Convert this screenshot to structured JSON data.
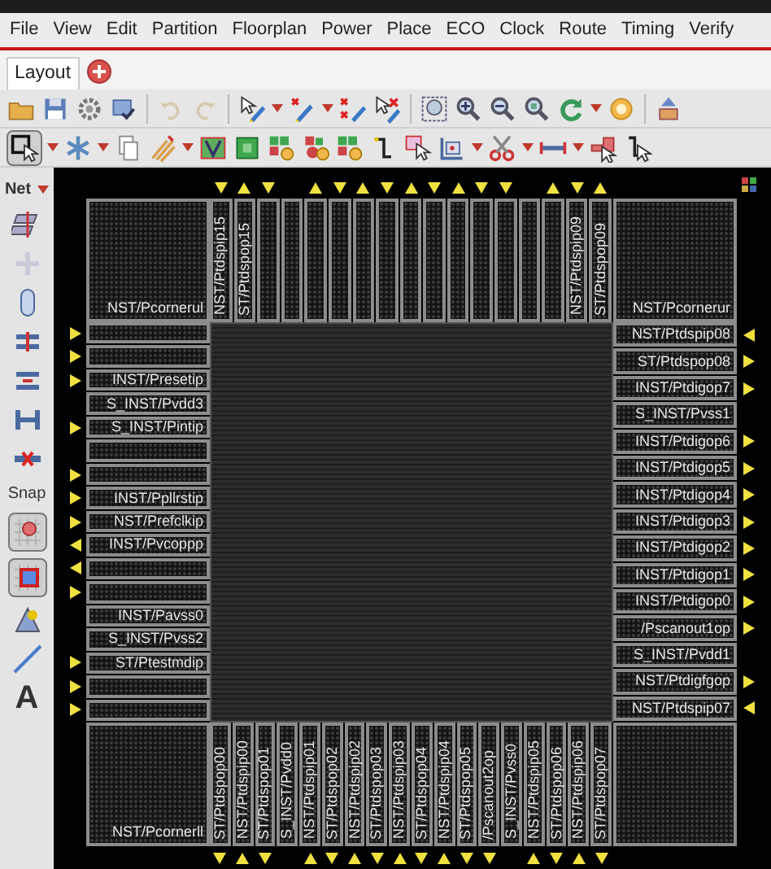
{
  "menu": [
    "File",
    "View",
    "Edit",
    "Partition",
    "Floorplan",
    "Power",
    "Place",
    "ECO",
    "Clock",
    "Route",
    "Timing",
    "Verify"
  ],
  "tabs": [
    {
      "label": "Layout",
      "selected": true
    }
  ],
  "palette": {
    "net_label": "Net",
    "snap_label": "Snap",
    "text_tool": "A"
  },
  "die": {
    "corners": [
      {
        "label": "NST/Pcornerul"
      },
      {
        "label": "NST/Pcornerur"
      },
      {
        "label": "NST/Pcornerll"
      }
    ],
    "top": [
      {
        "label": "NST/Ptdspip15",
        "arrow": true,
        "inward": true
      },
      {
        "label": "ST/Ptdspop15",
        "arrow": true,
        "inward": false
      },
      {
        "arrow": true,
        "inward": true
      },
      {
        "arrow": false
      },
      {
        "arrow": true,
        "inward": false
      },
      {
        "arrow": true,
        "inward": true
      },
      {
        "arrow": true,
        "inward": false
      },
      {
        "arrow": true,
        "inward": true
      },
      {
        "arrow": true,
        "inward": false
      },
      {
        "arrow": true,
        "inward": true
      },
      {
        "arrow": true,
        "inward": false
      },
      {
        "arrow": true,
        "inward": true
      },
      {
        "arrow": true,
        "inward": true
      },
      {
        "arrow": false
      },
      {
        "arrow": true,
        "inward": false
      },
      {
        "label": "NST/Ptdspip09",
        "arrow": true,
        "inward": true
      },
      {
        "label": "ST/Ptdspop09",
        "arrow": true,
        "inward": false
      }
    ],
    "left": [
      {
        "arrow": true,
        "inward": true
      },
      {
        "arrow": true,
        "inward": true
      },
      {
        "label": "INST/Presetip",
        "arrow": true,
        "inward": true
      },
      {
        "label": "S_INST/Pvdd3",
        "arrow": false
      },
      {
        "label": "S_INST/Pintip",
        "arrow": true,
        "inward": true
      },
      {
        "arrow": false
      },
      {
        "arrow": true,
        "inward": true
      },
      {
        "label": "INST/Ppllrstip",
        "arrow": true,
        "inward": true
      },
      {
        "label": "NST/Prefclkip",
        "arrow": true,
        "inward": true
      },
      {
        "label": "INST/Pvcoppp",
        "arrow": true,
        "inward": false
      },
      {
        "arrow": true,
        "inward": false
      },
      {
        "arrow": true,
        "inward": true
      },
      {
        "label": "INST/Pavss0",
        "arrow": false
      },
      {
        "label": "S_INST/Pvss2",
        "arrow": false
      },
      {
        "label": "ST/Ptestmdip",
        "arrow": true,
        "inward": true
      },
      {
        "arrow": true,
        "inward": true
      },
      {
        "arrow": true,
        "inward": true
      }
    ],
    "right": [
      {
        "label": "NST/Ptdspip08",
        "arrow": true,
        "inward": true
      },
      {
        "label": "ST/Ptdspop08",
        "arrow": true,
        "inward": false
      },
      {
        "label": "INST/Ptdigop7",
        "arrow": true,
        "inward": false
      },
      {
        "label": "S_INST/Pvss1",
        "arrow": false
      },
      {
        "label": "INST/Ptdigop6",
        "arrow": true,
        "inward": false
      },
      {
        "label": "INST/Ptdigop5",
        "arrow": true,
        "inward": false
      },
      {
        "label": "INST/Ptdigop4",
        "arrow": true,
        "inward": false
      },
      {
        "label": "INST/Ptdigop3",
        "arrow": true,
        "inward": false
      },
      {
        "label": "INST/Ptdigop2",
        "arrow": true,
        "inward": false
      },
      {
        "label": "INST/Ptdigop1",
        "arrow": true,
        "inward": false
      },
      {
        "label": "INST/Ptdigop0",
        "arrow": true,
        "inward": false
      },
      {
        "label": "/Pscanout1op",
        "arrow": true,
        "inward": false
      },
      {
        "label": "S_INST/Pvdd1",
        "arrow": false
      },
      {
        "label": "NST/Ptdigfgop",
        "arrow": true,
        "inward": false
      },
      {
        "label": "NST/Ptdspip07",
        "arrow": true,
        "inward": true
      }
    ],
    "bottom": [
      {
        "label": "ST/Ptdspop00",
        "arrow": true,
        "inward": false
      },
      {
        "label": "NST/Ptdspip00",
        "arrow": true,
        "inward": true
      },
      {
        "label": "ST/Ptdspop01",
        "arrow": true,
        "inward": false
      },
      {
        "label": "S_INST/Pvdd0",
        "arrow": false
      },
      {
        "label": "NST/Ptdspip01",
        "arrow": true,
        "inward": true
      },
      {
        "label": "ST/Ptdspop02",
        "arrow": true,
        "inward": false
      },
      {
        "label": "NST/Ptdspip02",
        "arrow": true,
        "inward": true
      },
      {
        "label": "ST/Ptdspop03",
        "arrow": true,
        "inward": false
      },
      {
        "label": "NST/Ptdspip03",
        "arrow": true,
        "inward": true
      },
      {
        "label": "ST/Ptdspop04",
        "arrow": true,
        "inward": false
      },
      {
        "label": "NST/Ptdspip04",
        "arrow": true,
        "inward": true
      },
      {
        "label": "ST/Ptdspop05",
        "arrow": true,
        "inward": false
      },
      {
        "label": "/Pscanout2op",
        "arrow": true,
        "inward": false
      },
      {
        "label": "S_INST/Pvss0",
        "arrow": false
      },
      {
        "label": "NST/Ptdspip05",
        "arrow": true,
        "inward": true
      },
      {
        "label": "ST/Ptdspop06",
        "arrow": true,
        "inward": false
      },
      {
        "label": "NST/Ptdspip06",
        "arrow": true,
        "inward": true
      },
      {
        "label": "ST/Ptdspop07",
        "arrow": true,
        "inward": false
      }
    ]
  }
}
